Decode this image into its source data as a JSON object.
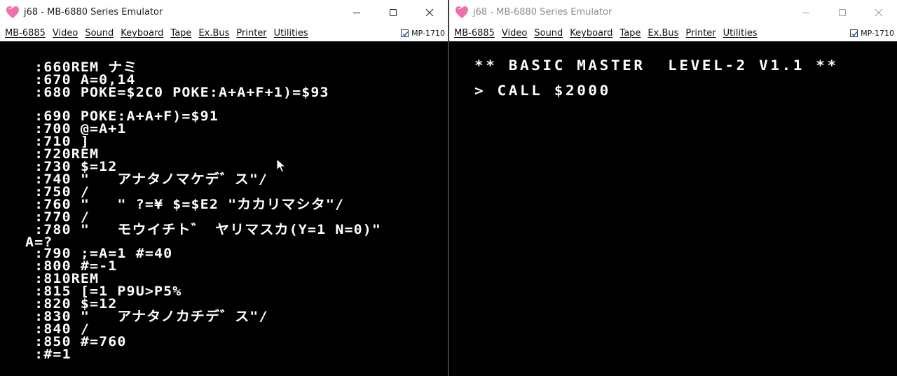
{
  "left_window": {
    "title": "j68 - MB-6880 Series Emulator",
    "menu": [
      "MB-6885",
      "Video",
      "Sound",
      "Keyboard",
      "Tape",
      "Ex.Bus",
      "Printer",
      "Utilities"
    ],
    "mp_label": "MP-1710",
    "mp_checked": true,
    "screen_lines": [
      " :660REM ナミ",
      " :670 A=0,14",
      " :680 POKE=$2C0 POKE:A+A+F+1)=$93",
      " :690 POKE:A+A+F)=$91",
      " :700 @=A+1",
      " :710 ]",
      " :720REM",
      " :730 $=12",
      " :740 \"   アナタノマケデ゛ス\"/",
      " :750 /",
      " :760 \"   \" ?=¥ $=$E2 \"カカリマシタ\"/",
      " :770 /",
      " :780 \"   モウイチト゛ ヤリマスカ(Y=1 N=0)\"",
      "A=?",
      " :790 ;=A=1 #=40",
      " :800 #=-1",
      " :810REM",
      " :815 [=1 P9U>P5%",
      " :820 $=12",
      " :830 \"   アナタノカチデ゛ス\"/",
      " :840 /",
      " :850 #=760",
      " :#=1"
    ]
  },
  "right_window": {
    "title": "j68 - MB-6880 Series Emulator",
    "menu": [
      "MB-6885",
      "Video",
      "Sound",
      "Keyboard",
      "Tape",
      "Ex.Bus",
      "Printer",
      "Utilities"
    ],
    "mp_label": "MP-1710",
    "mp_checked": true,
    "screen_lines": [
      "** BASIC MASTER  LEVEL-2 V1.1 **",
      "> CALL $2000"
    ]
  },
  "colors": {
    "screen_bg": "#000000",
    "screen_text": "#ffffff",
    "app_icon": "#f06fa8"
  }
}
